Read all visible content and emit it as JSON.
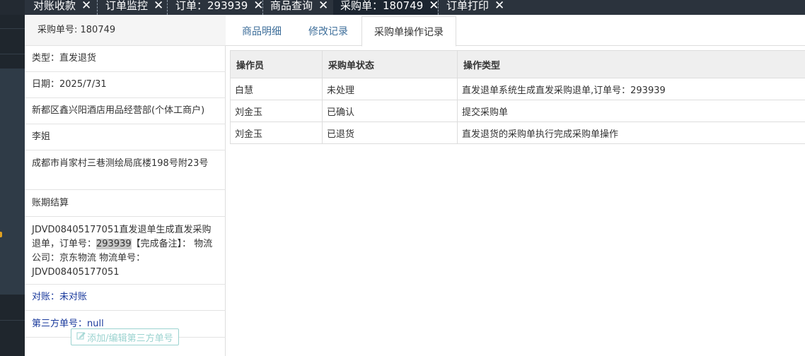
{
  "top_tabs": [
    {
      "label": "对账收款",
      "active": false
    },
    {
      "label": "订单监控",
      "active": false
    },
    {
      "label": "订单：293939",
      "active": false
    },
    {
      "label": "商品查询",
      "active": false
    },
    {
      "label": "采购单：180749",
      "active": true
    },
    {
      "label": "订单打印",
      "active": false
    }
  ],
  "info_panel": {
    "header": "采购单号: 180749",
    "type": "类型：直发退货",
    "date": "日期：2025/7/31",
    "supplier": "新都区鑫兴阳酒店用品经营部(个体工商户)",
    "contact": "李姐",
    "address": "成都市肖家村三巷测绘局底楼198号附23号",
    "settlement": "账期结算",
    "remark_prefix": "JDVD08405177051直发退单生成直发采购退单，订单号：",
    "remark_order": "293939",
    "remark_suffix": "【完成备注】： 物流公司：京东物流 物流单号：JDVD08405177051",
    "reconcile": "对账：未对账",
    "third_party": "第三方单号：null",
    "add_third_party_button": "添加/编辑第三方单号"
  },
  "sub_tabs": [
    {
      "label": "商品明细",
      "active": false
    },
    {
      "label": "修改记录",
      "active": false
    },
    {
      "label": "采购单操作记录",
      "active": true
    }
  ],
  "table": {
    "columns": [
      "操作员",
      "采购单状态",
      "操作类型"
    ],
    "rows": [
      [
        "白慧",
        "未处理",
        "直发退单系统生成直发采购退单,订单号：293939"
      ],
      [
        "刘金玉",
        "已确认",
        "提交采购单"
      ],
      [
        "刘金玉",
        "已退货",
        "直发退货的采购单执行完成采购单操作"
      ]
    ]
  },
  "colors": {
    "topbar": "#2b333d",
    "nav": "#1f262d",
    "link_blue": "#1a3a9c",
    "tab_text": "#3d6e9a",
    "button_border": "#9bd3d0"
  }
}
